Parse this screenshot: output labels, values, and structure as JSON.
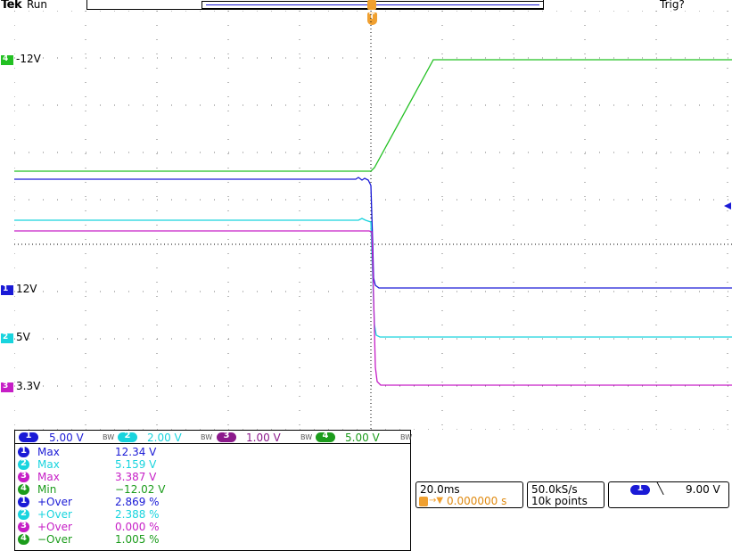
{
  "header": {
    "logo": "Tek",
    "run_status": "Run",
    "trigger_status": "Trig?"
  },
  "channels": [
    {
      "id": "1",
      "color": "#1a1ad6",
      "ref_label": "12V"
    },
    {
      "id": "2",
      "color": "#19d4de",
      "ref_label": "5V"
    },
    {
      "id": "3",
      "color": "#c61ec6",
      "ref_label": "3.3V"
    },
    {
      "id": "4",
      "color": "#22c022",
      "ref_label": "-12V"
    }
  ],
  "trigger_marker": "T",
  "scale_bar": [
    {
      "channel": "1",
      "value": "5.00 V",
      "bw": "BW",
      "color": "#1a1ad6"
    },
    {
      "channel": "2",
      "value": "2.00 V",
      "bw": "BW",
      "color": "#19d4de"
    },
    {
      "channel": "3",
      "value": "1.00 V",
      "bw": "BW",
      "color": "#8c1a8c"
    },
    {
      "channel": "4",
      "value": "5.00 V",
      "bw": "BW",
      "color": "#1c9c1c"
    }
  ],
  "measurements": [
    {
      "channel": "1",
      "name": "Max",
      "value": "12.34 V",
      "color": "#1a1ad6"
    },
    {
      "channel": "2",
      "name": "Max",
      "value": "5.159 V",
      "color": "#19d4de"
    },
    {
      "channel": "3",
      "name": "Max",
      "value": "3.387 V",
      "color": "#c61ec6"
    },
    {
      "channel": "4",
      "name": "Min",
      "value": "−12.02 V",
      "color": "#1c9c1c"
    },
    {
      "channel": "1",
      "name": "+Over",
      "value": "2.869 %",
      "color": "#1a1ad6"
    },
    {
      "channel": "2",
      "name": "+Over",
      "value": "2.388 %",
      "color": "#19d4de"
    },
    {
      "channel": "3",
      "name": "+Over",
      "value": "0.000 %",
      "color": "#c61ec6"
    },
    {
      "channel": "4",
      "name": "−Over",
      "value": "1.005 %",
      "color": "#1c9c1c"
    }
  ],
  "horizontal": {
    "time_per_div": "20.0ms",
    "trigger_position": "0.000000 s",
    "trigger_position_icon": "trigger-position-icon"
  },
  "acquisition": {
    "sample_rate": "50.0kS/s",
    "record_length": "10k points"
  },
  "trigger": {
    "source": "1",
    "slope_icon": "falling-edge-icon",
    "slope_glyph": "╲",
    "level": "9.00 V"
  }
}
